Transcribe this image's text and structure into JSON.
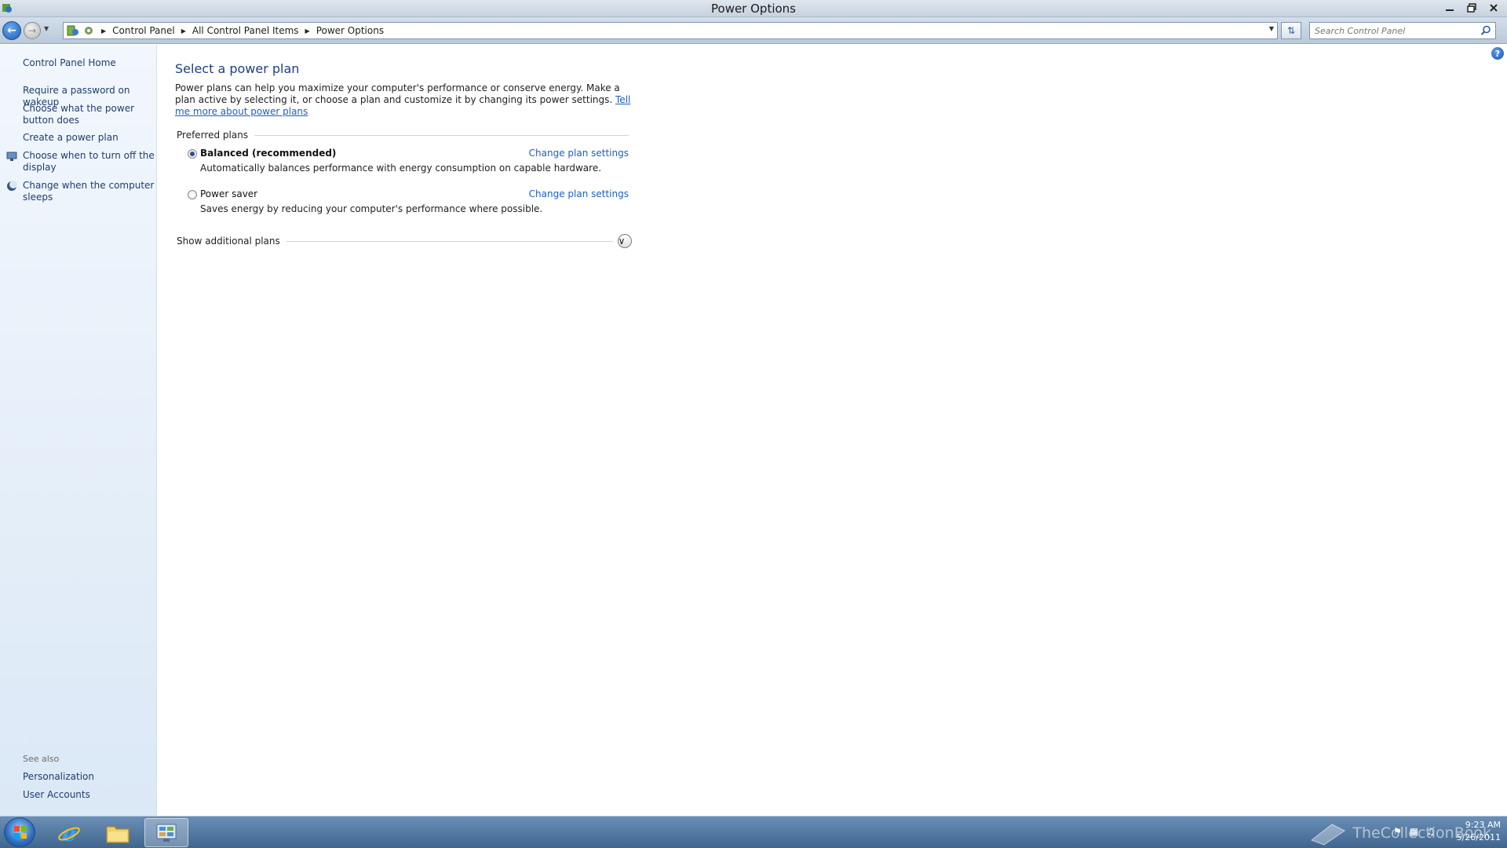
{
  "window": {
    "title": "Power Options"
  },
  "address": {
    "crumbs": [
      "Control Panel",
      "All Control Panel Items",
      "Power Options"
    ]
  },
  "search": {
    "placeholder": "Search Control Panel"
  },
  "sidebar": {
    "home": "Control Panel Home",
    "links": [
      "Require a password on wakeup",
      "Choose what the power button does",
      "Create a power plan",
      "Choose when to turn off the display",
      "Change when the computer sleeps"
    ],
    "see_also_heading": "See also",
    "see_also": [
      "Personalization",
      "User Accounts"
    ]
  },
  "main": {
    "title": "Select a power plan",
    "description": "Power plans can help you maximize your computer's performance or conserve energy. Make a plan active by selecting it, or choose a plan and customize it by changing its power settings.",
    "more_link": "Tell me more about power plans",
    "preferred_heading": "Preferred plans",
    "plans": [
      {
        "name": "Balanced (recommended)",
        "description": "Automatically balances performance with energy consumption on capable hardware.",
        "link": "Change plan settings",
        "selected": true
      },
      {
        "name": "Power saver",
        "description": "Saves energy by reducing your computer's performance where possible.",
        "link": "Change plan settings",
        "selected": false
      }
    ],
    "additional_heading": "Show additional plans"
  },
  "taskbar": {
    "time": "9:23 AM",
    "date": "5/26/2011",
    "watermark": "TheCollectionBook"
  },
  "colors": {
    "link": "#1c5ec6",
    "title": "#1e3f86",
    "sidebar_link": "#1e3d6e"
  }
}
